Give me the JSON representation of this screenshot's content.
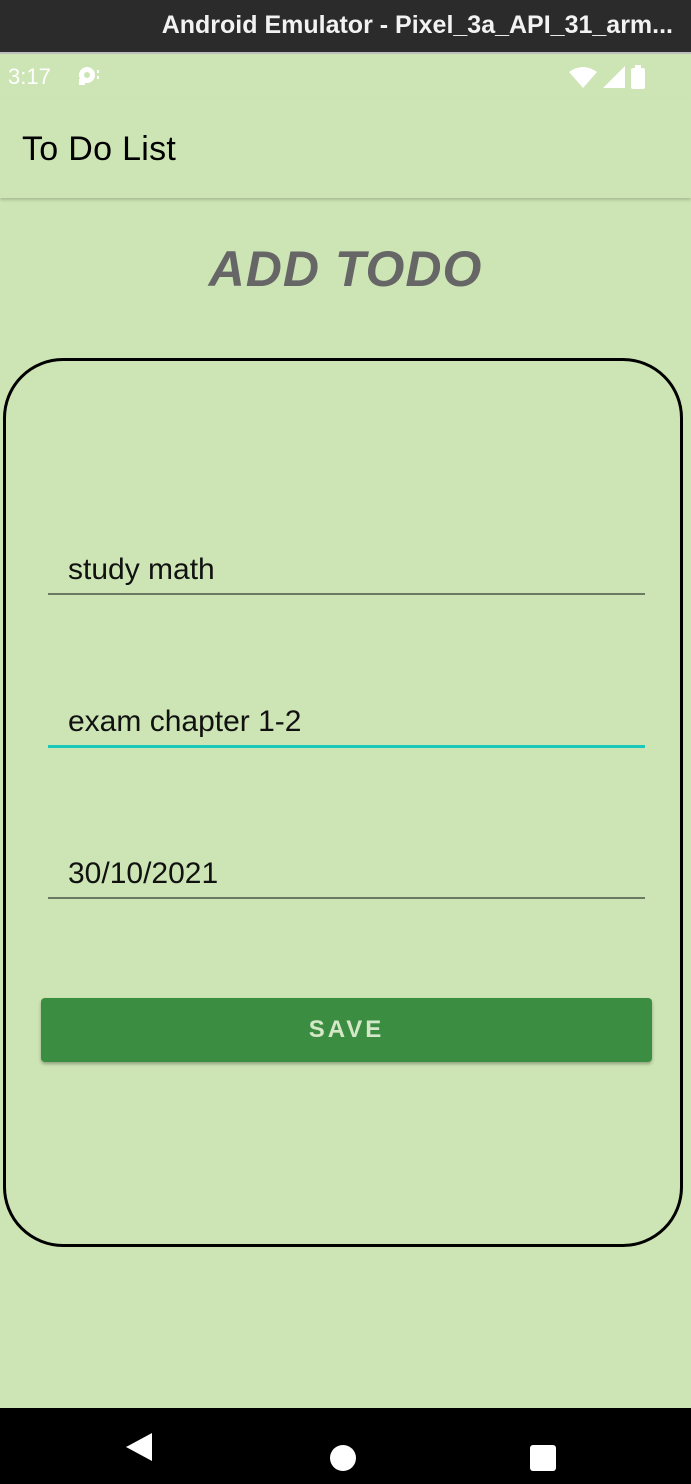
{
  "window": {
    "title": "Android Emulator - Pixel_3a_API_31_arm..."
  },
  "status_bar": {
    "time": "3:17",
    "icons": [
      "notification-icon",
      "wifi-icon",
      "signal-icon",
      "battery-icon"
    ]
  },
  "app_bar": {
    "title": "To Do List"
  },
  "screen": {
    "heading": "ADD TODO"
  },
  "form": {
    "title_value": "study math",
    "description_value": "exam chapter 1-2",
    "date_value": "30/10/2021",
    "save_label": "SAVE"
  },
  "nav_bar": {
    "icons": [
      "back-icon",
      "home-icon",
      "recents-icon"
    ]
  },
  "colors": {
    "background": "#cde5b4",
    "primary_button": "#3b8d41",
    "focus_underline": "#19c8b8",
    "heading_text": "#666666"
  }
}
